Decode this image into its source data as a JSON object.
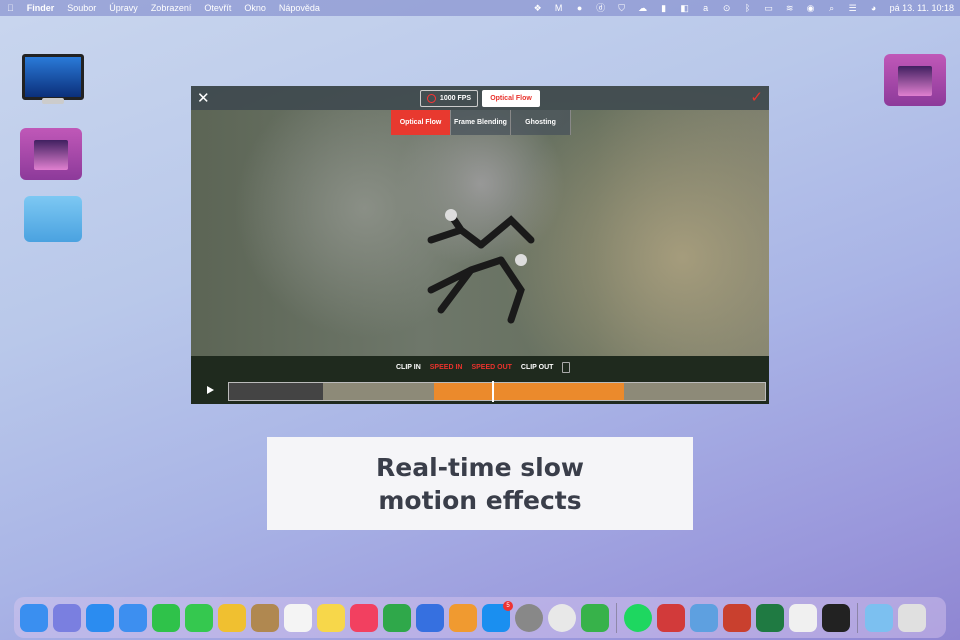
{
  "menubar": {
    "app": "Finder",
    "items": [
      "Soubor",
      "Úpravy",
      "Zobrazení",
      "Otevřít",
      "Okno",
      "Nápověda"
    ],
    "clock": "pá 13. 11.  10:18"
  },
  "editor": {
    "fps_label": "1000 FPS",
    "mode_label": "Optical Flow",
    "tabs": [
      "Optical Flow",
      "Frame Blending",
      "Ghosting"
    ],
    "controls": {
      "clip_in": "CLIP IN",
      "speed_in": "SPEED IN",
      "speed_out": "SPEED OUT",
      "clip_out": "CLIP OUT"
    },
    "playhead_fraction": 0.49
  },
  "caption": {
    "line1": "Real-time slow",
    "line2": "motion effects"
  },
  "dock": {
    "appstore_badge": "5",
    "apps": [
      "finder",
      "launchpad",
      "safari",
      "mail",
      "facetime",
      "messages",
      "photos",
      "contacts",
      "reminders",
      "notes",
      "music",
      "numbers",
      "keynote",
      "pages",
      "app-store",
      "system-preferences",
      "chrome",
      "feedly",
      "spotify",
      "parallels",
      "preview",
      "powerpoint",
      "excel",
      "script-editor",
      "terminal",
      "downloads-folder",
      "trash"
    ],
    "colors": [
      "#3a8ff0",
      "#7a7fe0",
      "#2b8cf0",
      "#3d8ff0",
      "#2fc24a",
      "#35c84f",
      "#f0c030",
      "#b08850",
      "#f4f4f4",
      "#f7d74a",
      "#f24060",
      "#2fa84a",
      "#3670e0",
      "#f09a30",
      "#1a8ff0",
      "#888",
      "#e8e8e8",
      "#37b24a",
      "#1ed760",
      "#d23a3a",
      "#5ea0e0",
      "#c9402e",
      "#1f7a42",
      "#f0f0f0",
      "#222",
      "#7cc0f0",
      "#e0e0e0"
    ]
  }
}
